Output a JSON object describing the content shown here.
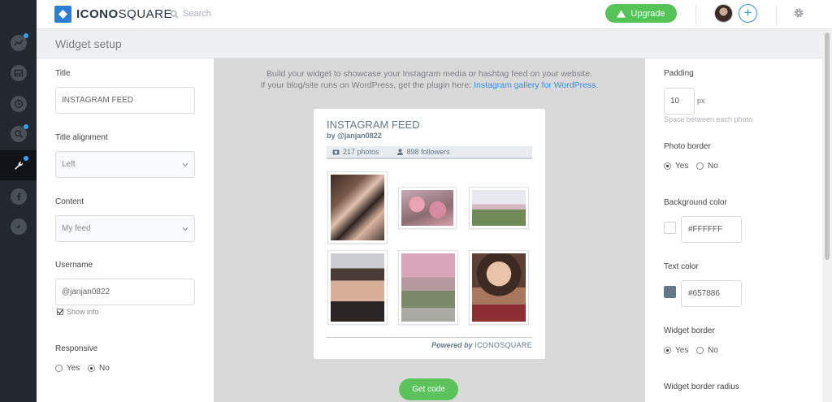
{
  "app": {
    "logo_part1": "ICONO",
    "logo_part2": "SQUARE",
    "search_placeholder": "Search",
    "upgrade_label": "Upgrade",
    "brand_color": "#2d7ed8",
    "accent_green": "#56c356"
  },
  "sidebar": {
    "items": [
      {
        "icon": "trend-chart-icon",
        "dot": true
      },
      {
        "icon": "media-icon",
        "dot": false
      },
      {
        "icon": "clock-icon",
        "dot": false
      },
      {
        "icon": "search-icon",
        "dot": true
      },
      {
        "icon": "wrench-icon",
        "dot": true,
        "active": true
      },
      {
        "icon": "facebook-icon",
        "dot": false
      },
      {
        "icon": "compass-icon",
        "dot": false
      }
    ]
  },
  "page": {
    "title": "Widget setup"
  },
  "left": {
    "title_label": "Title",
    "title_value": "INSTAGRAM FEED",
    "alignment_label": "Title alignment",
    "alignment_value": "Left",
    "content_label": "Content",
    "content_value": "My feed",
    "username_label": "Username",
    "username_value": "@janjan0822",
    "show_info_label": "Show info",
    "responsive_label": "Responsive",
    "yes_label": "Yes",
    "no_label": "No",
    "responsive_selected": "No"
  },
  "center": {
    "intro_line1": "Build your widget to showcase your Instagram media or hashtag feed on your website.",
    "intro_line2": "If your blog/site runs on WordPress, get the plugin here: ",
    "plugin_link": "Instagram gallery for WordPress.",
    "get_code_label": "Get code"
  },
  "widget": {
    "title": "INSTAGRAM FEED",
    "byline": "by @janjan0822",
    "photos_count": "217 photos",
    "followers_count": "898 followers",
    "powered_by": "Powered by",
    "powered_brand": "ICONOSQUARE",
    "text_color": "#657886"
  },
  "right": {
    "padding_label": "Padding",
    "padding_value": "10",
    "padding_unit": "px",
    "padding_hint": "Space between each photo",
    "photo_border_label": "Photo border",
    "photo_border_selected": "Yes",
    "bg_color_label": "Background color",
    "bg_color_value": "#FFFFFF",
    "text_color_label": "Text color",
    "text_color_value": "#657886",
    "widget_border_label": "Widget border",
    "widget_border_selected": "Yes",
    "widget_radius_label": "Widget border radius",
    "yes_label": "Yes",
    "no_label": "No"
  }
}
